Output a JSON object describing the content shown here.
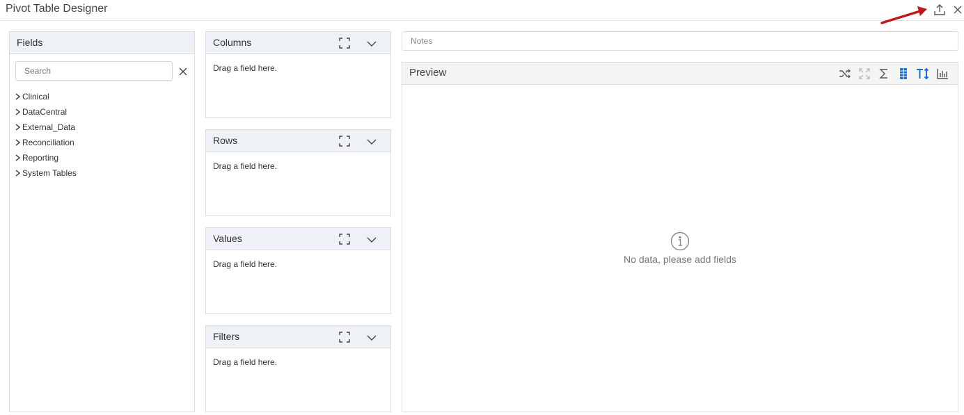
{
  "window": {
    "title": "Pivot Table Designer"
  },
  "icons": {
    "export": "upload-icon",
    "close": "close-icon",
    "annotation": "red-arrow-annotation"
  },
  "colors": {
    "accent": "#1a6fc4",
    "arrow": "#c0171c",
    "header_bg": "#eef2f7"
  },
  "fields": {
    "title": "Fields",
    "search_placeholder": "Search",
    "items": [
      {
        "label": "Clinical"
      },
      {
        "label": "DataCentral"
      },
      {
        "label": "External_Data"
      },
      {
        "label": "Reconciliation"
      },
      {
        "label": "Reporting"
      },
      {
        "label": "System Tables"
      }
    ]
  },
  "zones": {
    "columns": {
      "title": "Columns",
      "hint": "Drag a field here."
    },
    "rows": {
      "title": "Rows",
      "hint": "Drag a field here."
    },
    "values": {
      "title": "Values",
      "hint": "Drag a field here."
    },
    "filters": {
      "title": "Filters",
      "hint": "Drag a field here."
    }
  },
  "notes": {
    "placeholder": "Notes"
  },
  "preview": {
    "title": "Preview",
    "toolbar": [
      "shuffle-icon",
      "fullscreen-icon",
      "sigma-icon",
      "grid-icon",
      "text-size-icon",
      "bar-chart-icon"
    ],
    "empty_message": "No data, please add fields"
  }
}
